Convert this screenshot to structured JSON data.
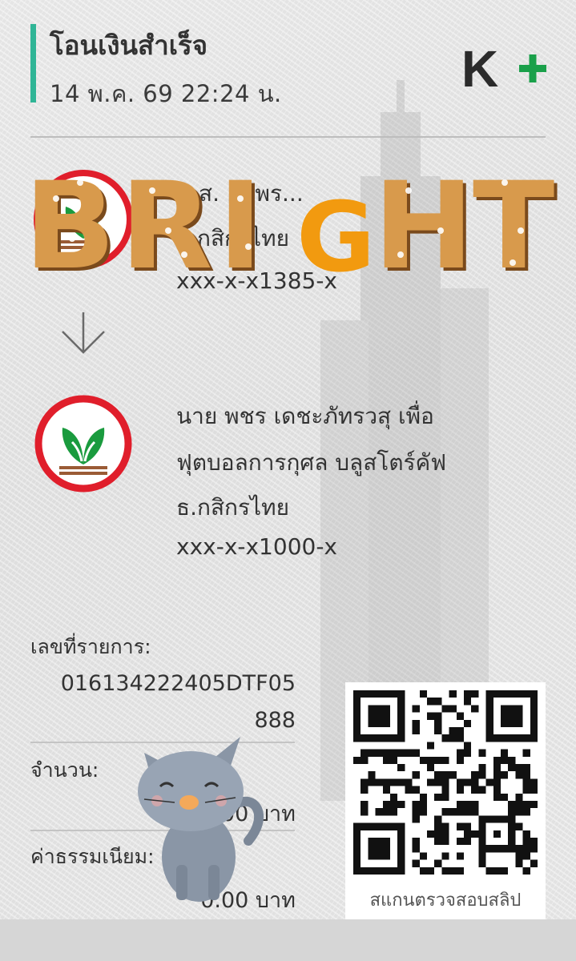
{
  "header": {
    "title": "โอนเงินสำเร็จ",
    "datetime": "14 พ.ค. 69  22:24 น.",
    "logo": "K+",
    "accent_color": "#2fb596",
    "logo_color": "#1aa04a"
  },
  "sender": {
    "name": "น.ส. ... พร...",
    "bank": "ธ.กสิกรไทย",
    "account": "xxx-x-x1385-x",
    "logo_icon": "kbank-logo"
  },
  "arrow_icon": "arrow-down-icon",
  "receiver": {
    "name_line1": "นาย พชร เดชะภัทรวสุ เพื่อ",
    "name_line2": "ฟุตบอลการกุศล บลูสโตร์คัฟ",
    "bank": "ธ.กสิกรไทย",
    "account": "xxx-x-x1000-x",
    "logo_icon": "kbank-logo"
  },
  "details": {
    "ref_label": "เลขที่รายการ:",
    "ref_line1": "016134222405DTF05",
    "ref_line2": "888",
    "amount_label": "จำนวน:",
    "amount_value": "3.00 บาท",
    "fee_label": "ค่าธรรมเนียม:",
    "fee_value": "0.00 บาท"
  },
  "qr": {
    "caption": "สแกนตรวจสอบสลิป"
  },
  "stickers": {
    "bright_text": "BRIGHT",
    "cat_icon": "cat-sticker"
  }
}
